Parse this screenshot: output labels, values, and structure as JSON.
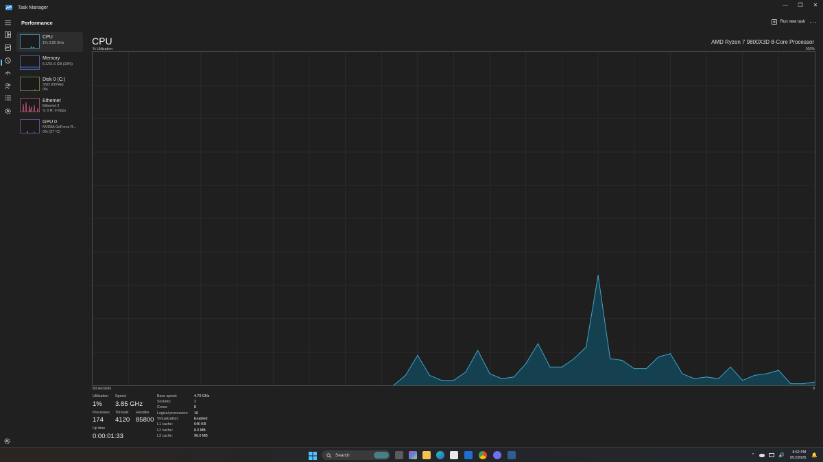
{
  "window": {
    "title": "Task Manager"
  },
  "header": {
    "title": "Performance",
    "run_new_task": "Run new task",
    "more": "···"
  },
  "sidebar": {
    "items": [
      {
        "name": "CPU",
        "sub1": "1% 3.85 GHz",
        "sub2": ""
      },
      {
        "name": "Memory",
        "sub1": "6.1/31.6 GB (19%)",
        "sub2": ""
      },
      {
        "name": "Disk 0 (C:)",
        "sub1": "SSD (NVMe)",
        "sub2": "0%"
      },
      {
        "name": "Ethernet",
        "sub1": "Ethernet 2",
        "sub2": "S: 0 R: 0 Kbps"
      },
      {
        "name": "GPU 0",
        "sub1": "NVIDIA GeForce R...",
        "sub2": "0% (37 °C)"
      }
    ]
  },
  "main": {
    "title": "CPU",
    "model": "AMD Ryzen 7 9800X3D 8-Core Processor",
    "util_label": "% Utilization",
    "util_max": "100%",
    "axis_left": "60 seconds",
    "axis_right": "0"
  },
  "stats": {
    "utilization_label": "Utilization",
    "utilization": "1%",
    "speed_label": "Speed",
    "speed": "3.85 GHz",
    "processes_label": "Processes",
    "processes": "174",
    "threads_label": "Threads",
    "threads": "4120",
    "handles_label": "Handles",
    "handles": "85800",
    "uptime_label": "Up time",
    "uptime": "0:00:01:33"
  },
  "specs": [
    {
      "k": "Base speed:",
      "v": "4.70 GHz"
    },
    {
      "k": "Sockets:",
      "v": "1"
    },
    {
      "k": "Cores:",
      "v": "8"
    },
    {
      "k": "Logical processors:",
      "v": "16"
    },
    {
      "k": "Virtualization:",
      "v": "Enabled"
    },
    {
      "k": "L1 cache:",
      "v": "640 KB"
    },
    {
      "k": "L2 cache:",
      "v": "8.0 MB"
    },
    {
      "k": "L3 cache:",
      "v": "96.0 MB"
    }
  ],
  "taskbar": {
    "search": "Search",
    "time": "8:52 PM",
    "date": "9/12/2026"
  },
  "colors": {
    "accent": "#6cc6f0",
    "graph_line": "#41a5c9",
    "graph_fill": "#15404f",
    "grid": "#333333"
  },
  "chart_data": {
    "type": "area",
    "ylim": [
      0,
      100
    ],
    "xlim": [
      60,
      0
    ],
    "x": [
      35,
      34,
      33,
      32,
      31,
      30,
      29,
      28,
      27,
      26,
      25,
      24,
      23,
      22,
      21,
      20,
      19,
      18,
      17,
      16,
      15,
      14,
      13,
      12,
      11,
      10,
      9,
      8,
      7,
      6,
      5,
      4,
      3,
      2,
      1,
      0
    ],
    "values": [
      0,
      3,
      9,
      3,
      1.5,
      1.5,
      4,
      10.5,
      3.5,
      2,
      2.5,
      6.5,
      12.5,
      5.5,
      5.5,
      8,
      11.5,
      33,
      8,
      7.5,
      5,
      5,
      8.5,
      9.5,
      3.5,
      2,
      2.5,
      2,
      5.5,
      1.5,
      3,
      3.5,
      4.5,
      0.5,
      0.5,
      1
    ]
  }
}
